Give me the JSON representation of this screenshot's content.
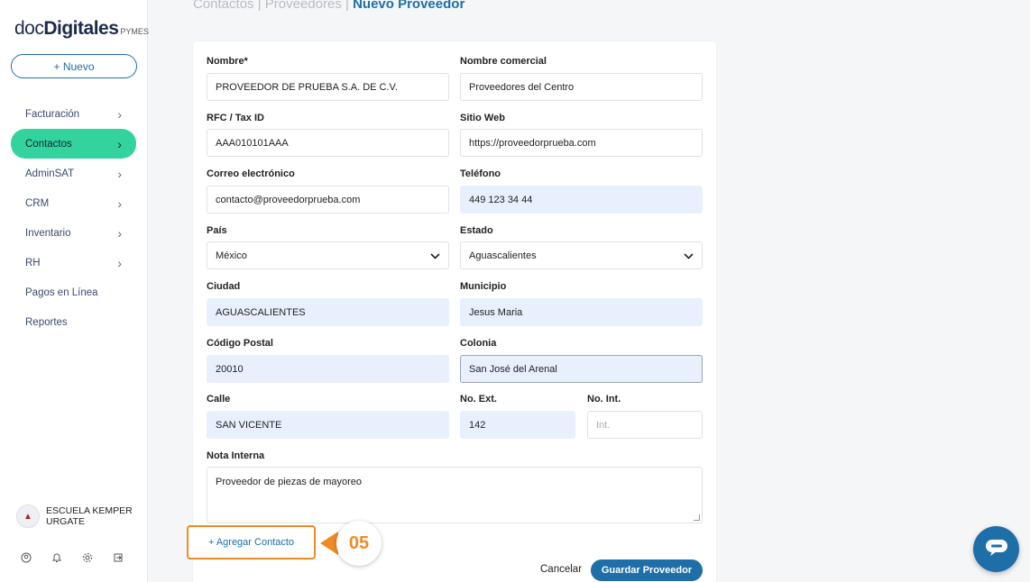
{
  "sidebar": {
    "logo": {
      "doc": "doc",
      "digitales": "Digitales",
      "pymes": "PYMES"
    },
    "new_button": "+ Nuevo",
    "items": [
      {
        "label": "Facturación",
        "chevron": true,
        "active": false
      },
      {
        "label": "Contactos",
        "chevron": true,
        "active": true
      },
      {
        "label": "AdminSAT",
        "chevron": true,
        "active": false
      },
      {
        "label": "CRM",
        "chevron": true,
        "active": false
      },
      {
        "label": "Inventario",
        "chevron": true,
        "active": false
      },
      {
        "label": "RH",
        "chevron": true,
        "active": false
      },
      {
        "label": "Pagos en Línea",
        "chevron": false,
        "active": false
      },
      {
        "label": "Reportes",
        "chevron": false,
        "active": false
      }
    ],
    "school_name": "ESCUELA KEMPER URGATE",
    "bottom_icons": [
      "user-circle-icon",
      "bell-icon",
      "gear-icon",
      "logout-icon"
    ]
  },
  "breadcrumb": {
    "part1": "Contactos",
    "sep": " | ",
    "part2": "Proveedores",
    "current": "Nuevo Proveedor"
  },
  "form": {
    "nombre_label": "Nombre*",
    "nombre_value": "PROVEEDOR DE PRUEBA S.A. DE C.V.",
    "nombre_comercial_label": "Nombre comercial",
    "nombre_comercial_value": "Proveedores del Centro",
    "rfc_label": "RFC / Tax ID",
    "rfc_value": "AAA010101AAA",
    "sitio_label": "Sitio Web",
    "sitio_value": "https://proveedorprueba.com",
    "correo_label": "Correo electrónico",
    "correo_value": "contacto@proveedorprueba.com",
    "telefono_label": "Teléfono",
    "telefono_value": "449 123 34 44",
    "pais_label": "País",
    "pais_value": "México",
    "estado_label": "Estado",
    "estado_value": "Aguascalientes",
    "ciudad_label": "Ciudad",
    "ciudad_value": "AGUASCALIENTES",
    "municipio_label": "Municipio",
    "municipio_value": "Jesus Maria",
    "cp_label": "Código Postal",
    "cp_value": "20010",
    "colonia_label": "Colonia",
    "colonia_value": "San José del Arenal",
    "calle_label": "Calle",
    "calle_value": "SAN VICENTE",
    "noext_label": "No. Ext.",
    "noext_value": "142",
    "noint_label": "No. Int.",
    "noint_placeholder": "Int.",
    "nota_label": "Nota Interna",
    "nota_value": "Proveedor de piezas de mayoreo"
  },
  "actions": {
    "add_contact": "+ Agregar Contacto",
    "step_number": "05",
    "cancel": "Cancelar",
    "save": "Guardar Proveedor"
  },
  "colors": {
    "accent": "#1e6fa8",
    "active_nav": "#33d39d",
    "highlight": "#f08a24"
  }
}
